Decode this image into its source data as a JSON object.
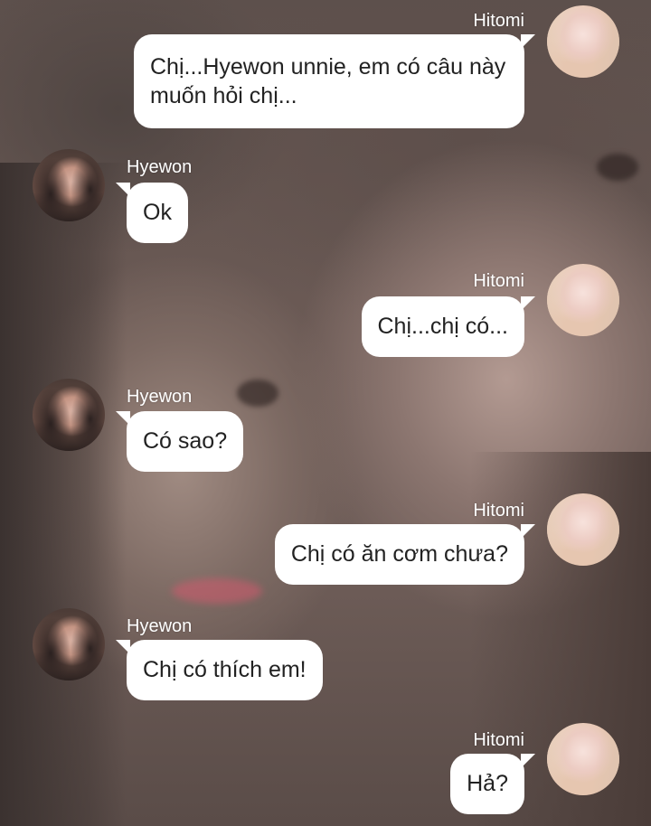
{
  "conversation": {
    "messages": [
      {
        "sender": "Hitomi",
        "side": "right",
        "text": "Chị...Hyewon unnie, em có câu này muốn hỏi chị..."
      },
      {
        "sender": "Hyewon",
        "side": "left",
        "text": "Ok"
      },
      {
        "sender": "Hitomi",
        "side": "right",
        "text": "Chị...chị có..."
      },
      {
        "sender": "Hyewon",
        "side": "left",
        "text": "Có sao?"
      },
      {
        "sender": "Hitomi",
        "side": "right",
        "text": "Chị có ăn cơm chưa?"
      },
      {
        "sender": "Hyewon",
        "side": "left",
        "text": "Chị có thích em!"
      },
      {
        "sender": "Hitomi",
        "side": "right",
        "text": "Hả?"
      }
    ]
  },
  "colors": {
    "bubble": "#ffffff",
    "bubble_text": "#222222",
    "name_text": "#ffffff"
  }
}
